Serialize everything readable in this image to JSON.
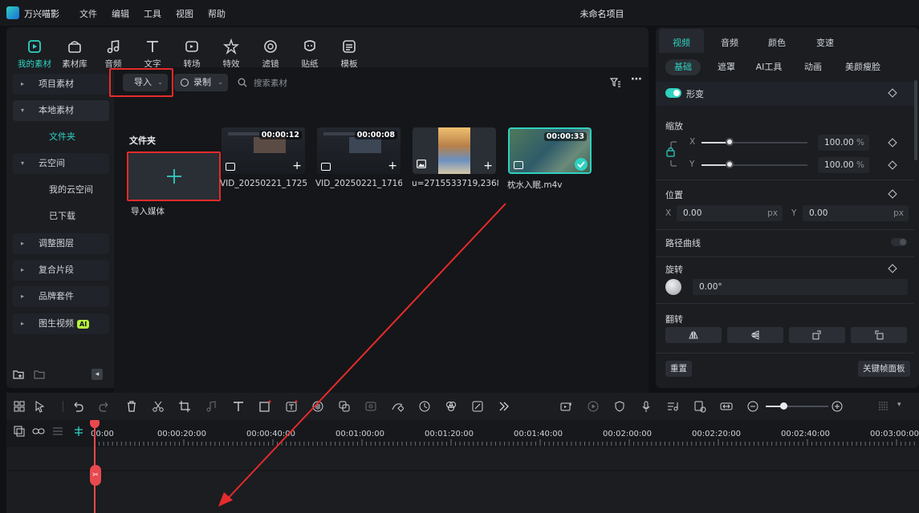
{
  "app": {
    "name": "万兴喵影",
    "project": "未命名项目"
  },
  "menu": [
    "文件",
    "编辑",
    "工具",
    "视图",
    "帮助"
  ],
  "toolbar_tabs": [
    "我的素材",
    "素材库",
    "音频",
    "文字",
    "转场",
    "特效",
    "滤镜",
    "贴纸",
    "模板"
  ],
  "sidebar": {
    "items": [
      {
        "label": "项目素材"
      },
      {
        "label": "本地素材"
      },
      {
        "label": "文件夹"
      },
      {
        "label": "云空间"
      },
      {
        "label": "我的云空间"
      },
      {
        "label": "已下载"
      },
      {
        "label": "调整图层"
      },
      {
        "label": "复合片段"
      },
      {
        "label": "品牌套件"
      },
      {
        "label": "图生视频",
        "badge": "AI"
      }
    ]
  },
  "media": {
    "import_label": "导入",
    "record_label": "录制",
    "search_placeholder": "搜索素材",
    "folder_title": "文件夹",
    "import_media_label": "导入媒体",
    "items": [
      {
        "name": "VID_20250221_1725...",
        "duration": "00:00:12"
      },
      {
        "name": "VID_20250221_1716...",
        "duration": "00:00:08"
      },
      {
        "name": "u=2715533719,2368..."
      },
      {
        "name": "枕水入眠.m4v",
        "duration": "00:00:33"
      }
    ]
  },
  "inspector": {
    "tabs": [
      "视频",
      "音频",
      "颜色",
      "变速"
    ],
    "subtabs": [
      "基础",
      "遮罩",
      "AI工具",
      "动画",
      "美颜瘦脸"
    ],
    "transform_label": "形变",
    "scale_label": "缩放",
    "scale_x": "100.00",
    "scale_y": "100.00",
    "percent": "%",
    "x_label": "X",
    "y_label": "Y",
    "position_label": "位置",
    "pos_x": "0.00",
    "pos_y": "0.00",
    "px": "px",
    "path_curve_label": "路径曲线",
    "rotate_label": "旋转",
    "rotate_value": "0.00°",
    "flip_label": "翻转",
    "reset_label": "重置",
    "keyframe_label": "关键帧面板"
  },
  "timeline": {
    "ticks": [
      "00:00",
      "00:00:20:00",
      "00:00:40:00",
      "00:01:00:00",
      "00:01:20:00",
      "00:01:40:00",
      "00:02:00:00",
      "00:02:20:00",
      "00:02:40:00",
      "00:03:00:00"
    ]
  },
  "colors": {
    "accent": "#2fd1c1",
    "highlight": "#e62b2b",
    "ai_badge": "#b6f23d"
  }
}
